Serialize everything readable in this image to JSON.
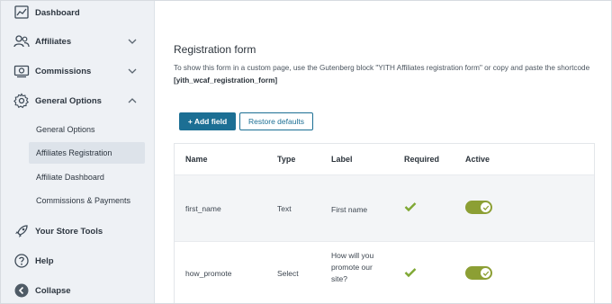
{
  "sidebar": {
    "items": [
      {
        "label": "Dashboard",
        "icon": "chart-icon"
      },
      {
        "label": "Affiliates",
        "icon": "users-icon"
      },
      {
        "label": "Commissions",
        "icon": "money-icon"
      },
      {
        "label": "General Options",
        "icon": "gear-icon"
      },
      {
        "label": "Your Store Tools",
        "icon": "rocket-icon"
      },
      {
        "label": "Help",
        "icon": "help-icon"
      },
      {
        "label": "Collapse",
        "icon": "collapse-icon"
      }
    ],
    "subitems": [
      {
        "label": "General Options"
      },
      {
        "label": "Affiliates Registration"
      },
      {
        "label": "Affiliate Dashboard"
      },
      {
        "label": "Commissions & Payments"
      }
    ]
  },
  "main": {
    "title": "Registration form",
    "description": "To show this form in a custom page, use the Gutenberg block \"YITH Affiliates registration form\" or copy and paste the shortcode",
    "shortcode": "[yith_wcaf_registration_form]",
    "add_field_label": "+ Add field",
    "restore_label": "Restore defaults",
    "table": {
      "headers": {
        "name": "Name",
        "type": "Type",
        "label": "Label",
        "required": "Required",
        "active": "Active"
      },
      "rows": [
        {
          "name": "first_name",
          "type": "Text",
          "label": "First name",
          "required": true,
          "active": true
        },
        {
          "name": "how_promote",
          "type": "Select",
          "label": "How will you promote our site?",
          "required": true,
          "active": true
        }
      ]
    }
  },
  "colors": {
    "primary": "#1c6f94",
    "toggle_on": "#8c9f34",
    "check": "#7fa834",
    "sidebar_bg": "#eef1f5"
  }
}
